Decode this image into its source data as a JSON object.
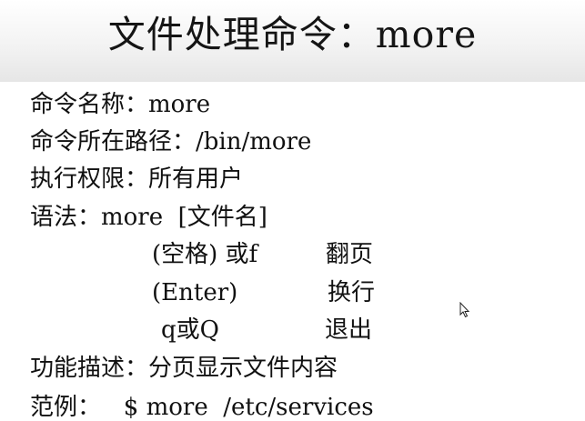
{
  "title": "文件处理命令：more",
  "lines": {
    "name": "命令名称：more",
    "path": "命令所在路径：/bin/more",
    "permission": "执行权限：所有用户",
    "syntax": "语法：more  [文件名]",
    "description": "功能描述：分页显示文件内容",
    "example": "范例：   $ more  /etc/services"
  },
  "options": [
    {
      "key": "(空格) 或f",
      "desc": "翻页"
    },
    {
      "key": "(Enter)",
      "desc": "换行"
    },
    {
      "key": "q或Q",
      "desc": "退出"
    }
  ],
  "icons": {
    "cursor": "mouse-pointer-icon"
  }
}
